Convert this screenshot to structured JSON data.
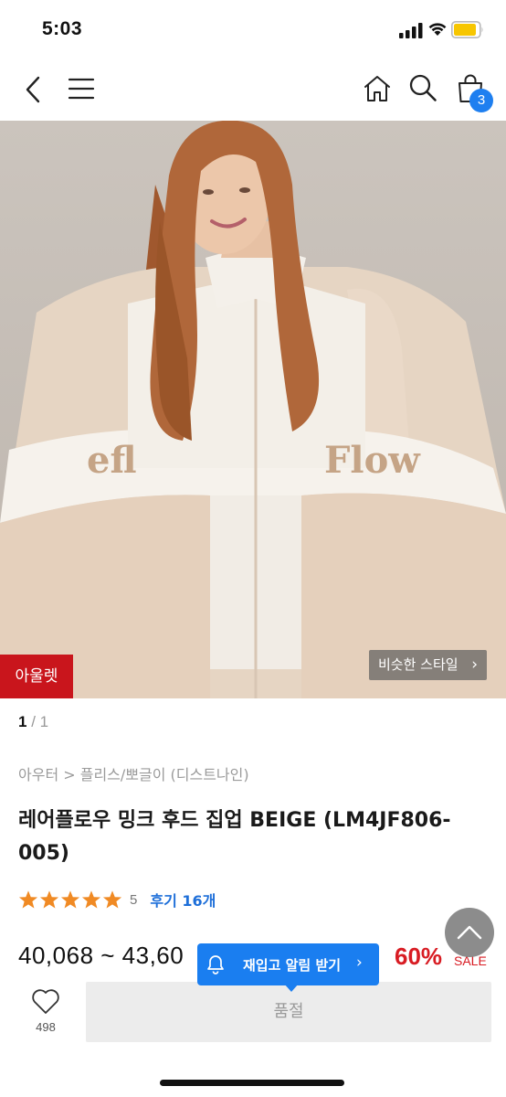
{
  "status_bar": {
    "time": "5:03"
  },
  "nav": {
    "cart_count": "3"
  },
  "hero": {
    "outlet_badge": "아울렛",
    "similar_style_label": "비슷한 스타일",
    "chevron": "›",
    "garment_text_left": "efl",
    "garment_text_right": "Flow"
  },
  "pagination": {
    "current": "1",
    "separator": "/",
    "total": "1"
  },
  "product": {
    "breadcrumb": "아우터 > 플리스/뽀글이 (디스트나인)",
    "title": "레어플로우 밍크 후드 집업 BEIGE (LM4JF806-005)",
    "rating": "5",
    "star_count": 5,
    "review_link": "후기 16개",
    "price": "40,068 ~ 43,60",
    "discount": "60%",
    "sale_label": "SALE"
  },
  "restock": {
    "label": "재입고 알림 받기",
    "chevron": "›"
  },
  "bottom_bar": {
    "wish_count": "498",
    "soldout_label": "품절"
  },
  "colors": {
    "accent_blue": "#1a7ef0",
    "sale_red": "#d81c23",
    "outlet_red": "#c9151c",
    "star_orange": "#f08a24"
  }
}
